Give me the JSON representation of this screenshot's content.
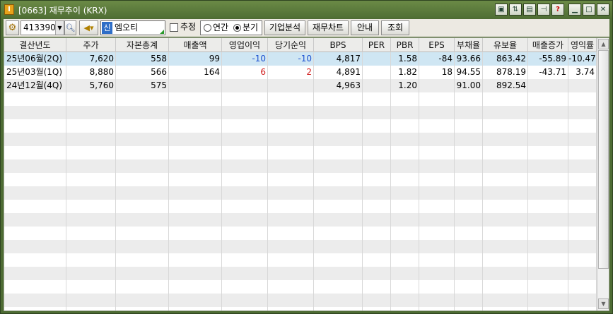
{
  "window": {
    "title": "[0663] 재무추이 (KRX)",
    "app_icon": "I"
  },
  "titlebar_buttons": [
    "arrange-icon",
    "link-icon",
    "print-icon",
    "pin-icon",
    "help-icon",
    "minimize-icon",
    "maximize-icon",
    "close-icon"
  ],
  "toolbar": {
    "stock_code": "413390",
    "stock_badge": "신",
    "stock_name": "엠오티",
    "estimate_label": "추정",
    "estimate_checked": false,
    "period_annual": "연간",
    "period_quarterly": "분기",
    "period_selected": "분기",
    "btn_company_analysis": "기업분석",
    "btn_financial_chart": "재무차트",
    "btn_guide": "안내",
    "btn_query": "조회"
  },
  "table": {
    "headers": [
      "결산년도",
      "주가",
      "자본총계",
      "매출액",
      "영업이익",
      "당기순익",
      "BPS",
      "PER",
      "PBR",
      "EPS",
      "부채율",
      "유보율",
      "매출증가",
      "영익률"
    ],
    "rows": [
      [
        "25년06월(2Q)",
        "7,620",
        "558",
        "99",
        "-10",
        "-10",
        "4,817",
        "",
        "1.58",
        "-84",
        "93.66",
        "863.42",
        "-55.89",
        "-10.47"
      ],
      [
        "25년03월(1Q)",
        "8,880",
        "566",
        "164",
        "6",
        "2",
        "4,891",
        "",
        "1.82",
        "18",
        "94.55",
        "878.19",
        "-43.71",
        "3.74"
      ],
      [
        "24년12월(4Q)",
        "5,760",
        "575",
        "",
        "",
        "",
        "4,963",
        "",
        "1.20",
        "",
        "91.00",
        "892.54",
        "",
        ""
      ]
    ],
    "selected_row": 0
  },
  "colors": {
    "window_frame": "#4d6b33",
    "selected_row": "#cfe6f3",
    "stripe": "#ececec",
    "negative": "#1a4fd0",
    "positive": "#d01a1a"
  }
}
